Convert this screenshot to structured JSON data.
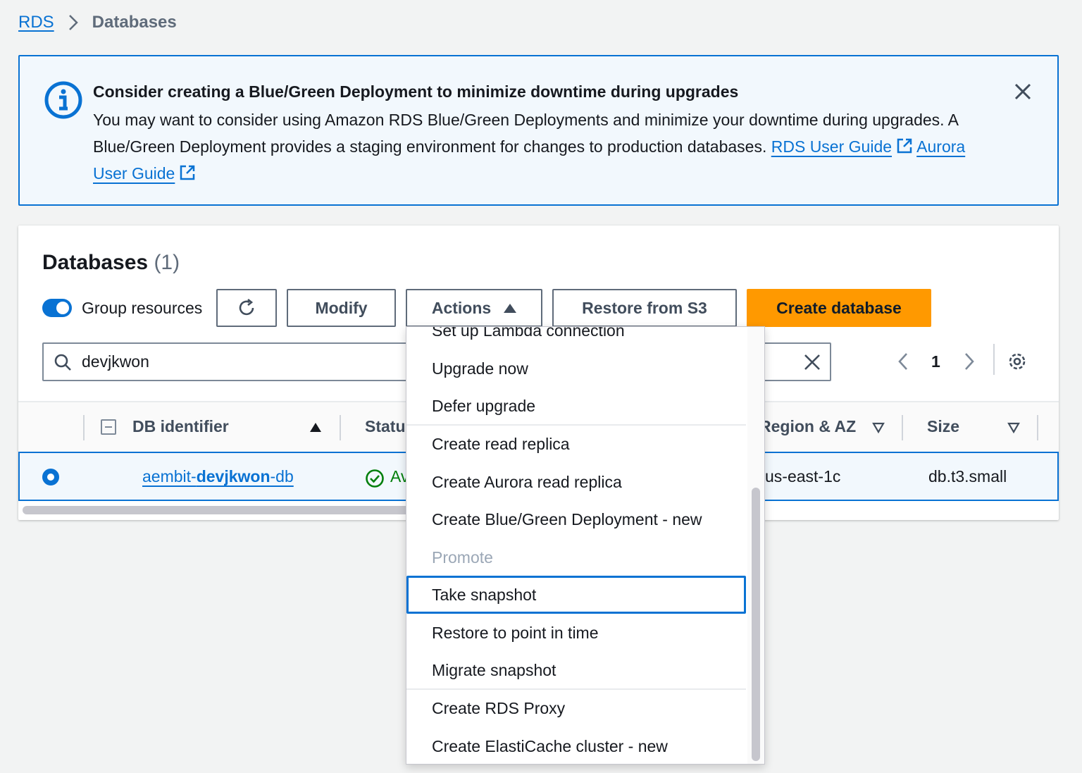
{
  "breadcrumb": {
    "root": "RDS",
    "current": "Databases"
  },
  "alert": {
    "title": "Consider creating a Blue/Green Deployment to minimize downtime during upgrades",
    "body": "You may want to consider using Amazon RDS Blue/Green Deployments and minimize your downtime during upgrades. A Blue/Green Deployment provides a staging environment for changes to production databases.",
    "link1": "RDS User Guide",
    "link2": "Aurora User Guide"
  },
  "panel": {
    "title": "Databases",
    "count": "(1)",
    "toggle_label": "Group resources",
    "modify_label": "Modify",
    "actions_label": "Actions",
    "restore_label": "Restore from S3",
    "create_label": "Create database",
    "search_value": "devjkwon",
    "page": "1"
  },
  "table": {
    "headers": {
      "db_identifier": "DB identifier",
      "status": "Status",
      "region": "Region & AZ",
      "size": "Size"
    },
    "row": {
      "db_prefix": "aembit-",
      "db_match": "devjkwon",
      "db_suffix": "-db",
      "status": "Available",
      "region": "us-east-1c",
      "size": "db.t3.small"
    }
  },
  "dropdown": {
    "items": [
      "Set up Lambda connection",
      "Upgrade now",
      "Defer upgrade",
      "Create read replica",
      "Create Aurora read replica",
      "Create Blue/Green Deployment - new",
      "Promote",
      "Take snapshot",
      "Restore to point in time",
      "Migrate snapshot",
      "Create RDS Proxy",
      "Create ElastiCache cluster - new"
    ]
  },
  "colors": {
    "accent": "#0972d3",
    "primary_button": "#ff9900",
    "success": "#037f0c"
  }
}
